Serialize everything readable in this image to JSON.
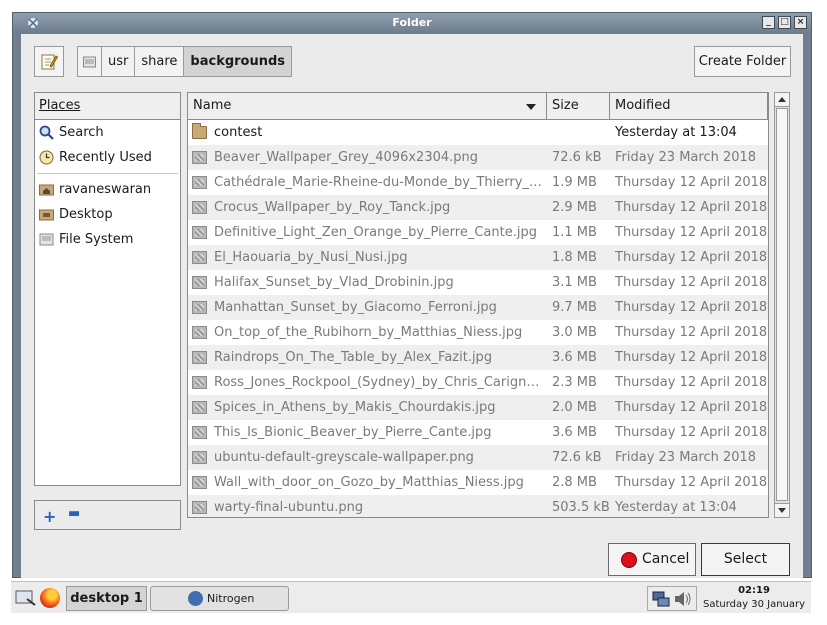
{
  "window": {
    "title": "Folder",
    "controls": [
      "minimize",
      "maximize",
      "close"
    ]
  },
  "path_bar": {
    "segments": [
      "usr",
      "share",
      "backgrounds"
    ],
    "active_index": 2
  },
  "create_folder_label": "Create Folder",
  "places": {
    "header": "Places",
    "items": [
      {
        "label": "Search",
        "icon": "search-icon"
      },
      {
        "label": "Recently Used",
        "icon": "clock-icon"
      },
      {
        "label": "ravaneswaran",
        "icon": "home-folder-icon"
      },
      {
        "label": "Desktop",
        "icon": "desktop-folder-icon"
      },
      {
        "label": "File System",
        "icon": "drive-icon"
      }
    ]
  },
  "file_list": {
    "columns": {
      "name": "Name",
      "size": "Size",
      "modified": "Modified"
    },
    "rows": [
      {
        "name": "contest",
        "size": "",
        "modified": "Yesterday at 13:04",
        "type": "folder"
      },
      {
        "name": "Beaver_Wallpaper_Grey_4096x2304.png",
        "size": "72.6 kB",
        "modified": "Friday 23 March 2018",
        "type": "image"
      },
      {
        "name": "Cathédrale_Marie-Rheine-du-Monde_by_Thierry_…",
        "size": "1.9 MB",
        "modified": "Thursday 12 April 2018",
        "type": "image"
      },
      {
        "name": "Crocus_Wallpaper_by_Roy_Tanck.jpg",
        "size": "2.9 MB",
        "modified": "Thursday 12 April 2018",
        "type": "image"
      },
      {
        "name": "Definitive_Light_Zen_Orange_by_Pierre_Cante.jpg",
        "size": "1.1 MB",
        "modified": "Thursday 12 April 2018",
        "type": "image"
      },
      {
        "name": "El_Haouaria_by_Nusi_Nusi.jpg",
        "size": "1.8 MB",
        "modified": "Thursday 12 April 2018",
        "type": "image"
      },
      {
        "name": "Halifax_Sunset_by_Vlad_Drobinin.jpg",
        "size": "3.1 MB",
        "modified": "Thursday 12 April 2018",
        "type": "image"
      },
      {
        "name": "Manhattan_Sunset_by_Giacomo_Ferroni.jpg",
        "size": "9.7 MB",
        "modified": "Thursday 12 April 2018",
        "type": "image"
      },
      {
        "name": "On_top_of_the_Rubihorn_by_Matthias_Niess.jpg",
        "size": "3.0 MB",
        "modified": "Thursday 12 April 2018",
        "type": "image"
      },
      {
        "name": "Raindrops_On_The_Table_by_Alex_Fazit.jpg",
        "size": "3.6 MB",
        "modified": "Thursday 12 April 2018",
        "type": "image"
      },
      {
        "name": "Ross_Jones_Rockpool_(Sydney)_by_Chris_Carign…",
        "size": "2.3 MB",
        "modified": "Thursday 12 April 2018",
        "type": "image"
      },
      {
        "name": "Spices_in_Athens_by_Makis_Chourdakis.jpg",
        "size": "2.0 MB",
        "modified": "Thursday 12 April 2018",
        "type": "image"
      },
      {
        "name": "This_Is_Bionic_Beaver_by_Pierre_Cante.jpg",
        "size": "3.6 MB",
        "modified": "Thursday 12 April 2018",
        "type": "image"
      },
      {
        "name": "ubuntu-default-greyscale-wallpaper.png",
        "size": "72.6 kB",
        "modified": "Friday 23 March 2018",
        "type": "image"
      },
      {
        "name": "Wall_with_door_on_Gozo_by_Matthias_Niess.jpg",
        "size": "2.8 MB",
        "modified": "Thursday 12 April 2018",
        "type": "image"
      },
      {
        "name": "warty-final-ubuntu.png",
        "size": "503.5 kB",
        "modified": "Yesterday at 13:04",
        "type": "image"
      }
    ]
  },
  "buttons": {
    "cancel": "Cancel",
    "select": "Select"
  },
  "taskbar": {
    "desktop_label": "desktop 1",
    "app_label": "Nitrogen",
    "time": "02:19",
    "date": "Saturday 30 January"
  },
  "colors": {
    "titlebar": "#7f8f9e",
    "cancel_icon": "#d8121a",
    "link_blue": "#2a62b8"
  }
}
